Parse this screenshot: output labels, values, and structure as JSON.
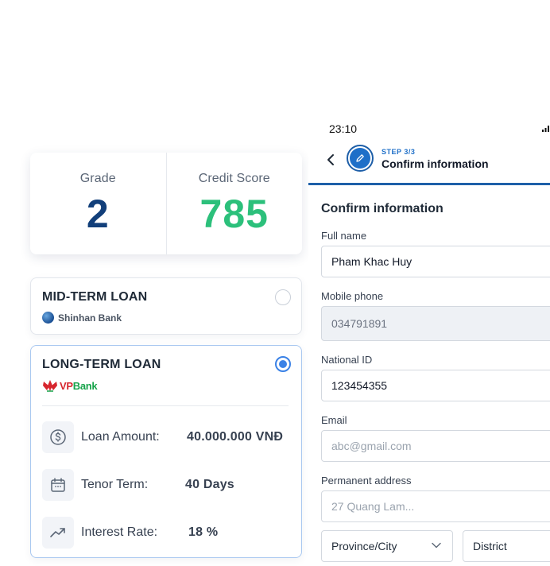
{
  "score_card": {
    "grade_label": "Grade",
    "grade_value": "2",
    "credit_label": "Credit Score",
    "credit_value": "785",
    "colors": {
      "grade": "#123f7a",
      "credit": "#2cc07b"
    }
  },
  "loans": {
    "mid_term": {
      "title": "MID-TERM LOAN",
      "bank": "Shinhan Bank",
      "selected": false
    },
    "long_term": {
      "title": "LONG-TERM LOAN",
      "bank_prefix": "VP",
      "bank_suffix": "Bank",
      "selected": true,
      "details": [
        {
          "icon": "dollar-circle-icon",
          "label": "Loan Amount:",
          "value": "40.000.000 VNĐ"
        },
        {
          "icon": "calendar-icon",
          "label": "Tenor Term:",
          "value": "40 Days"
        },
        {
          "icon": "trending-up-icon",
          "label": "Interest Rate:",
          "value": "18 %"
        }
      ]
    }
  },
  "phone": {
    "status_time": "23:10",
    "header": {
      "step_label": "STEP 3/3",
      "title": "Confirm information",
      "badge_icon": "pencil-icon",
      "back_icon": "chevron-left-icon"
    },
    "form": {
      "section_title": "Confirm information",
      "full_name": {
        "label": "Full name",
        "value": "Pham Khac Huy"
      },
      "mobile_phone": {
        "label": "Mobile phone",
        "value": "034791891"
      },
      "national_id": {
        "label": "National ID",
        "value": "123454355"
      },
      "email": {
        "label": "Email",
        "placeholder": "abc@gmail.com"
      },
      "permanent_address": {
        "label": "Permanent address",
        "placeholder": "27 Quang Lam..."
      },
      "province": {
        "label": "Province/City"
      },
      "district": {
        "label": "District"
      }
    },
    "accent_color": "#1e6fc8"
  }
}
